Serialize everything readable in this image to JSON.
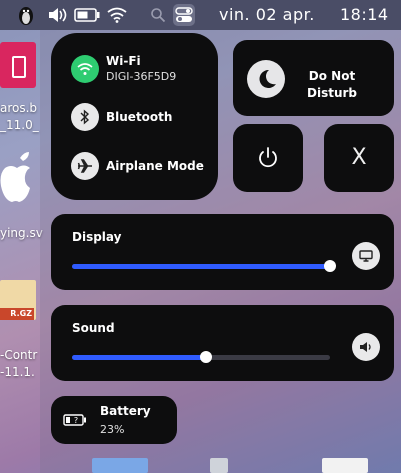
{
  "desktop": {
    "labels": [
      "aros.b",
      "_11.0_",
      "ying.sv",
      "R.GZ",
      "-Contr",
      "-11.1."
    ]
  },
  "topbar": {
    "date": "vin. 02 apr.",
    "time": "18:14"
  },
  "network": {
    "wifi": {
      "label": "Wi-Fi",
      "status": "DIGI-36F5D9",
      "active": true
    },
    "bluetooth": {
      "label": "Bluetooth"
    },
    "airplane": {
      "label": "Airplane Mode"
    }
  },
  "dnd": {
    "line1": "Do Not",
    "line2": "Disturb"
  },
  "close_label": "X",
  "display": {
    "title": "Display",
    "level": 1.0
  },
  "sound": {
    "title": "Sound",
    "level": 0.52
  },
  "battery": {
    "title": "Battery",
    "percent": "23%"
  },
  "colors": {
    "accent": "#2f5bff",
    "wifi_active": "#2ecc71",
    "tile_bg": "#0d0d0e"
  }
}
